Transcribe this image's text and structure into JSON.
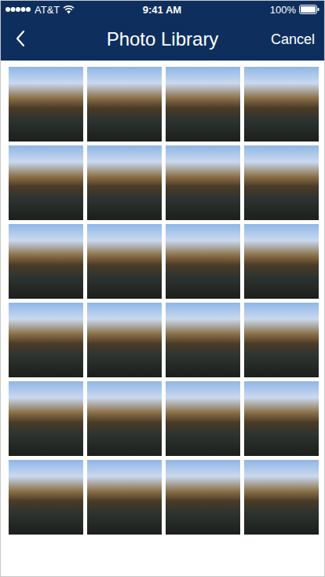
{
  "status_bar": {
    "carrier": "AT&T",
    "time": "9:41 AM",
    "battery": "100%",
    "battery_level": 1.0
  },
  "nav_bar": {
    "title": "Photo Library",
    "cancel": "Cancel"
  },
  "photos": [
    {
      "selected": false
    },
    {
      "selected": false
    },
    {
      "selected": false
    },
    {
      "selected": false
    },
    {
      "selected": false
    },
    {
      "selected": false
    },
    {
      "selected": false
    },
    {
      "selected": false
    },
    {
      "selected": false
    },
    {
      "selected": false
    },
    {
      "selected": false
    },
    {
      "selected": false
    },
    {
      "selected": false
    },
    {
      "selected": false
    },
    {
      "selected": false
    },
    {
      "selected": false
    },
    {
      "selected": false
    },
    {
      "selected": false
    },
    {
      "selected": false
    },
    {
      "selected": false
    },
    {
      "selected": false
    },
    {
      "selected": false
    },
    {
      "selected": false
    },
    {
      "selected": false
    }
  ]
}
